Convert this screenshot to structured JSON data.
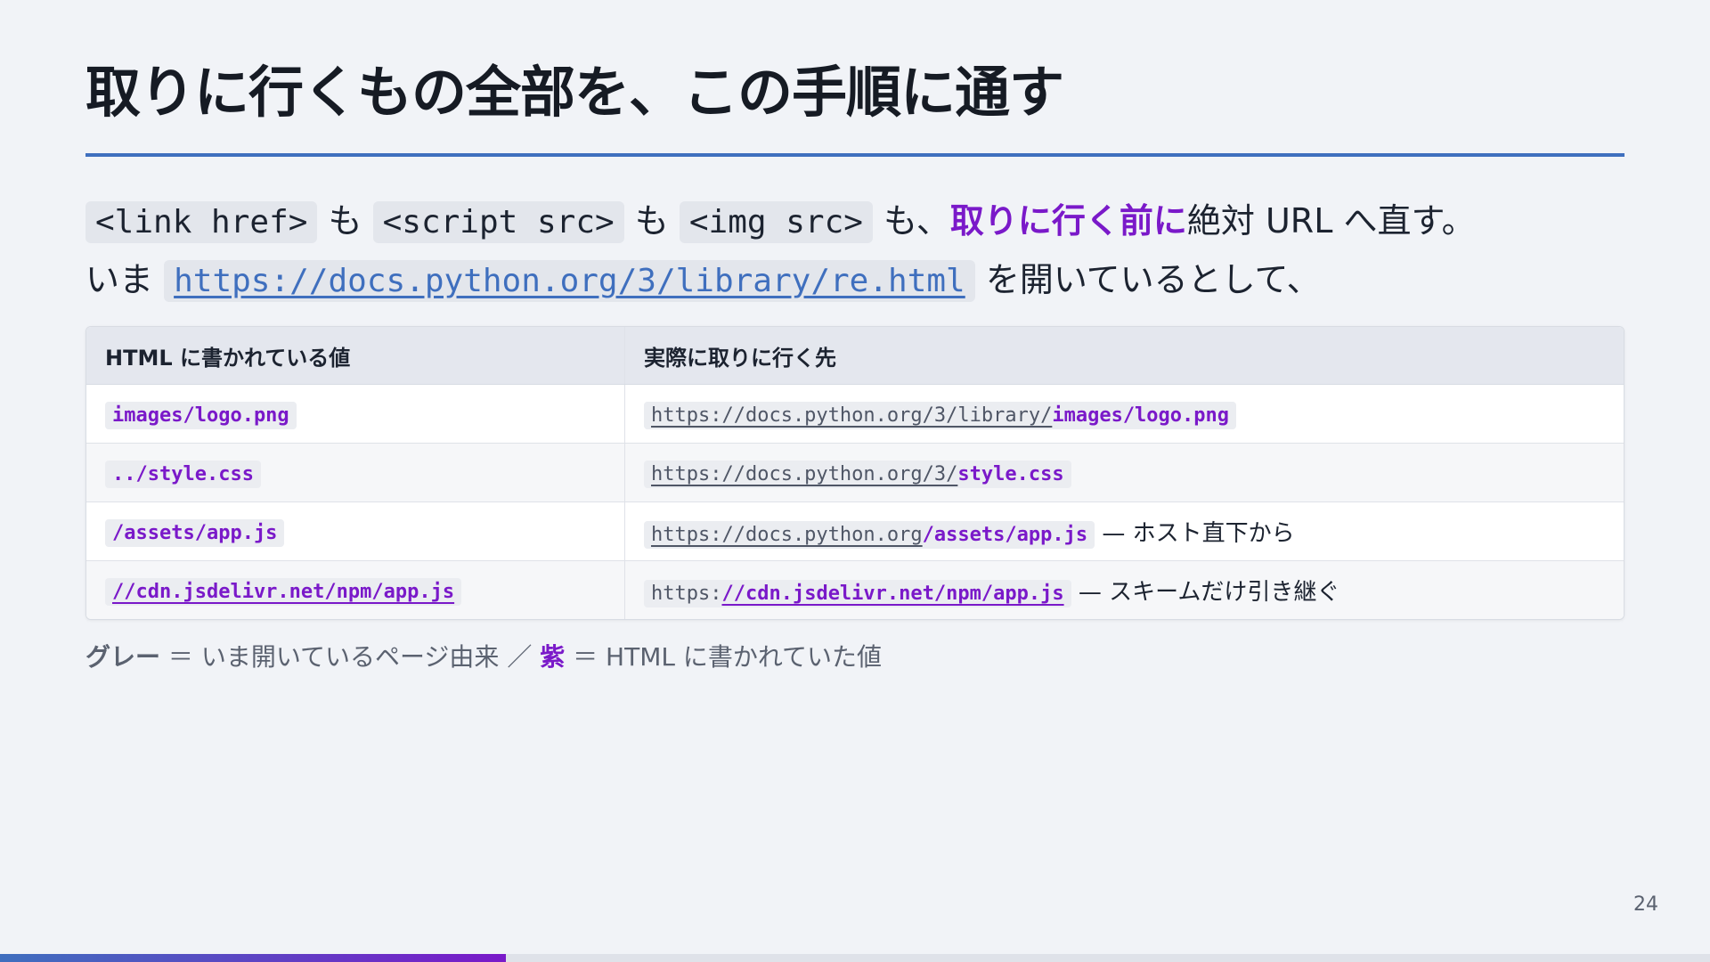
{
  "title": "取りに行くもの全部を、この手順に通す",
  "lead": {
    "line1": {
      "code1": "<link href>",
      "mo1": " も ",
      "code2": "<script src>",
      "mo2": " も ",
      "code3": "<img src>",
      "mo3": " も、",
      "emph": "取りに行く前に",
      "tail": "絶対 URL へ直す。"
    },
    "line2": {
      "prefix": "いま ",
      "url": "https://docs.python.org/3/library/re.html",
      "suffix": " を開いているとして、"
    }
  },
  "table": {
    "headers": [
      "HTML に書かれている値",
      "実際に取りに行く先"
    ],
    "rows": [
      {
        "value": "images/logo.png",
        "base": "https://docs.python.org/3/library/",
        "path": "images/logo.png",
        "note": ""
      },
      {
        "value": "../style.css",
        "base": "https://docs.python.org/3/",
        "path": "style.css",
        "note": ""
      },
      {
        "value": "/assets/app.js",
        "base": "https://docs.python.org",
        "path": "/assets/app.js",
        "note": " — ホスト直下から"
      },
      {
        "value": "//cdn.jsdelivr.net/npm/app.js",
        "base": "https:",
        "path": "//cdn.jsdelivr.net/npm/app.js",
        "note": " — スキームだけ引き継ぐ"
      }
    ]
  },
  "legend": {
    "gray_label": "グレー",
    "gray_desc": " ＝ いま開いているページ由来 ／ ",
    "purple_label": "紫",
    "purple_desc": " ＝ HTML に書かれていた値"
  },
  "page_number": "24",
  "progress": 0.296,
  "colors": {
    "accent": "#7a19c9",
    "link": "#3f6fbe",
    "rule": "#3f6fbe"
  }
}
